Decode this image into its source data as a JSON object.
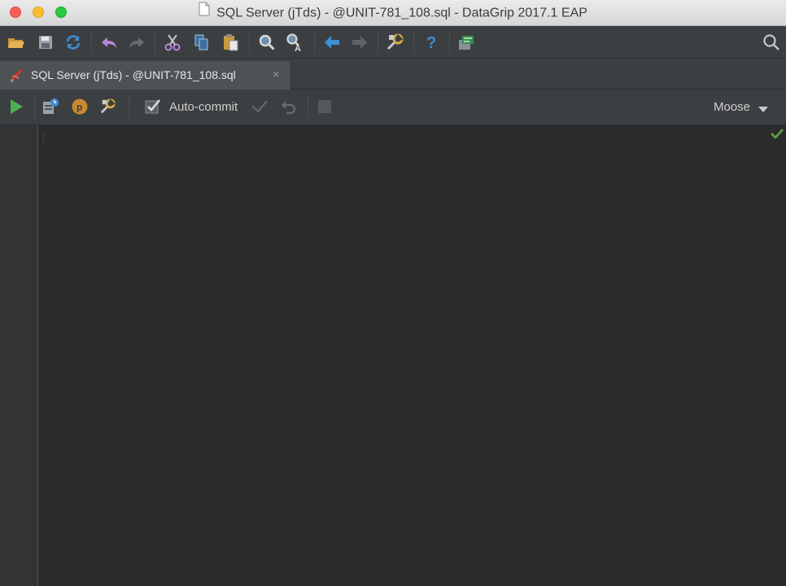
{
  "window": {
    "title": "SQL Server (jTds) - @UNIT-781_108.sql - DataGrip 2017.1 EAP"
  },
  "main_toolbar": {
    "icons": [
      "open-folder-icon",
      "save-icon",
      "sync-icon",
      "undo-icon",
      "redo-icon",
      "cut-icon",
      "copy-icon",
      "paste-icon",
      "find-icon",
      "replace-icon",
      "back-icon",
      "forward-icon",
      "settings-icon",
      "help-icon",
      "database-console-icon",
      "search-everywhere-icon"
    ]
  },
  "tab": {
    "label": "SQL Server (jTds) - @UNIT-781_108.sql",
    "close": "×"
  },
  "editor_toolbar": {
    "auto_commit_label": "Auto-commit",
    "auto_commit_checked": true,
    "schema_label": "Moose"
  },
  "colors": {
    "run": "#4caf50",
    "accent_blue": "#3d8fd6",
    "undo_purple": "#b687d8",
    "ok_green": "#5e9c3f"
  }
}
